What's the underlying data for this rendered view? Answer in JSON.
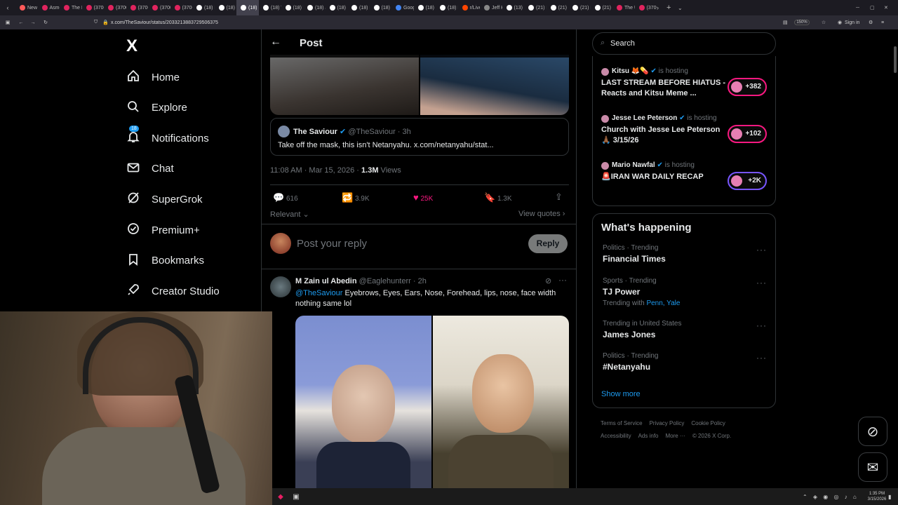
{
  "browser": {
    "tabs": [
      {
        "label": "New T",
        "color": "#ff5a5a"
      },
      {
        "label": "Asmo",
        "color": "#e0245e"
      },
      {
        "label": "The R",
        "color": "#e0245e"
      },
      {
        "label": "(3700",
        "color": "#e0245e"
      },
      {
        "label": "(3700",
        "color": "#e0245e"
      },
      {
        "label": "(3700",
        "color": "#e0245e"
      },
      {
        "label": "(3700",
        "color": "#e0245e"
      },
      {
        "label": "(3700",
        "color": "#e0245e"
      },
      {
        "label": "(18) F",
        "color": "#ffffff"
      },
      {
        "label": "(18) T",
        "color": "#ffffff"
      },
      {
        "label": "(18)",
        "color": "#ffffff",
        "active": true
      },
      {
        "label": "(18) T",
        "color": "#ffffff"
      },
      {
        "label": "(18) T",
        "color": "#ffffff"
      },
      {
        "label": "(18) Ji",
        "color": "#ffffff"
      },
      {
        "label": "(18) V",
        "color": "#ffffff"
      },
      {
        "label": "(18) E",
        "color": "#ffffff"
      },
      {
        "label": "(18) G",
        "color": "#ffffff"
      },
      {
        "label": "Goog",
        "color": "#4285f4"
      },
      {
        "label": "(18) E",
        "color": "#ffffff"
      },
      {
        "label": "(18) H",
        "color": "#ffffff"
      },
      {
        "label": "r/Live",
        "color": "#ff4500"
      },
      {
        "label": "Jeff K",
        "color": "#888888"
      },
      {
        "label": "(13) H",
        "color": "#ffffff"
      },
      {
        "label": "(21) H",
        "color": "#ffffff"
      },
      {
        "label": "(21) H",
        "color": "#ffffff"
      },
      {
        "label": "(21) E",
        "color": "#ffffff"
      },
      {
        "label": "(21) G",
        "color": "#ffffff"
      },
      {
        "label": "The U",
        "color": "#e0245e"
      },
      {
        "label": "(3700",
        "color": "#e0245e"
      }
    ],
    "url": "x.com/TheSaviour/status/2033213883729506375",
    "zoom": "150%",
    "signin": "Sign in"
  },
  "nav": {
    "logo": "X",
    "items": [
      {
        "label": "Home",
        "icon": "home-icon"
      },
      {
        "label": "Explore",
        "icon": "search-icon"
      },
      {
        "label": "Notifications",
        "icon": "bell-icon",
        "badge": "18"
      },
      {
        "label": "Chat",
        "icon": "mail-icon"
      },
      {
        "label": "SuperGrok",
        "icon": "grok-icon"
      },
      {
        "label": "Premium+",
        "icon": "verified-icon"
      },
      {
        "label": "Bookmarks",
        "icon": "bookmark-icon"
      },
      {
        "label": "Creator Studio",
        "icon": "rocket-icon"
      }
    ]
  },
  "post": {
    "header_title": "Post",
    "quote": {
      "author": "The Saviour",
      "handle": "@TheSaviour",
      "age": "3h",
      "text": "Take off the mask, this isn't Netanyahu. x.com/netanyahu/stat..."
    },
    "timestamp": "11:08 AM · Mar 15, 2026 · ",
    "views": "1.3M",
    "views_label": " Views",
    "replies": "616",
    "reposts": "3.9K",
    "likes": "25K",
    "bookmarks": "1.3K",
    "sort": "Relevant",
    "view_quotes": "View quotes",
    "reply_placeholder": "Post your reply",
    "reply_button": "Reply",
    "accent_like": "#f91880"
  },
  "reply": {
    "author": "M Zain ul Abedin",
    "handle": "@Eaglehunterr",
    "age": "2h",
    "mention": "@TheSaviour",
    "text": " Eyebrows, Eyes, Ears, Nose, Forehead, lips, nose, face width nothing same lol"
  },
  "sidebar": {
    "search_placeholder": "Search",
    "live": [
      {
        "host": "Kitsu",
        "emoji": "🦊💊",
        "status": "is hosting",
        "title": "LAST STREAM BEFORE HIATUS - Reacts and Kitsu Meme ...",
        "count": "+382"
      },
      {
        "host": "Jesse Lee Peterson",
        "emoji": "",
        "status": "is hosting",
        "title": "Church with Jesse Lee Peterson 🙏🏾 3/15/26",
        "count": "+102"
      },
      {
        "host": "Mario Nawfal",
        "emoji": "",
        "status": "is hosting",
        "title": "🚨IRAN WAR DAILY RECAP",
        "count": "+2K"
      }
    ],
    "happening_title": "What's happening",
    "trends": [
      {
        "meta": "Politics · Trending",
        "name": "Financial Times",
        "extra": ""
      },
      {
        "meta": "Sports · Trending",
        "name": "TJ Power",
        "extra": "Trending with",
        "links": "Penn, Yale"
      },
      {
        "meta": "Trending in United States",
        "name": "James Jones",
        "extra": ""
      },
      {
        "meta": "Politics · Trending",
        "name": "#Netanyahu",
        "extra": ""
      }
    ],
    "show_more": "Show more",
    "footer": [
      "Terms of Service",
      "Privacy Policy",
      "Cookie Policy",
      "Accessibility",
      "Ads info",
      "More ···",
      "© 2026 X Corp."
    ]
  },
  "taskbar": {
    "time": "1:35 PM",
    "date": "3/15/2026"
  },
  "colors": {
    "link": "#1d9bf0",
    "live_border": "#f91880",
    "live_border_alt": "#7856ff"
  }
}
